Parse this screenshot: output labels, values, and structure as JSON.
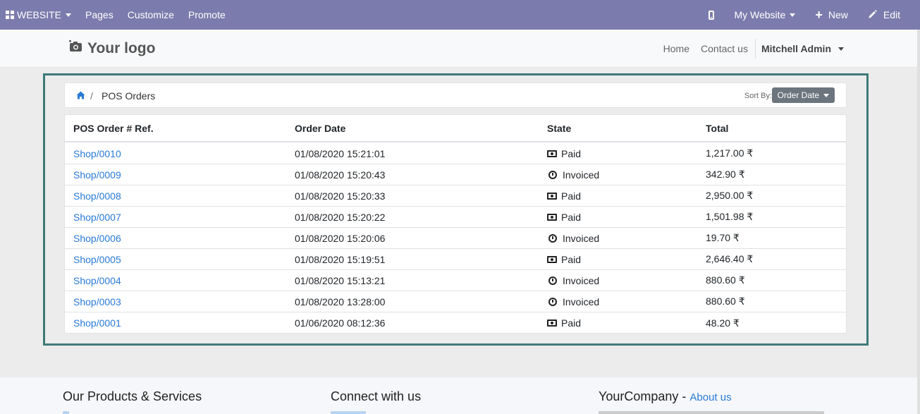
{
  "topbar": {
    "website_label": "WEBSITE",
    "pages_label": "Pages",
    "customize_label": "Customize",
    "promote_label": "Promote",
    "my_website_label": "My Website",
    "new_label": "New",
    "edit_label": "Edit"
  },
  "header": {
    "logo_text": "Your logo",
    "nav": [
      "Home",
      "Contact us"
    ],
    "user_name": "Mitchell Admin"
  },
  "breadcrumb": {
    "current": "POS Orders",
    "sort_label": "Sort By:",
    "sort_value": "Order Date"
  },
  "table": {
    "columns": [
      "POS Order # Ref.",
      "Order Date",
      "State",
      "Total"
    ],
    "rows": [
      {
        "ref": "Shop/0010",
        "date": "01/08/2020  15:21:01",
        "state": "Paid",
        "state_icon": "money-icon",
        "total": "1,217.00 ₹"
      },
      {
        "ref": "Shop/0009",
        "date": "01/08/2020  15:20:43",
        "state": "Invoiced",
        "state_icon": "clock-icon",
        "total": "342.90 ₹"
      },
      {
        "ref": "Shop/0008",
        "date": "01/08/2020  15:20:33",
        "state": "Paid",
        "state_icon": "money-icon",
        "total": "2,950.00 ₹"
      },
      {
        "ref": "Shop/0007",
        "date": "01/08/2020  15:20:22",
        "state": "Paid",
        "state_icon": "money-icon",
        "total": "1,501.98 ₹"
      },
      {
        "ref": "Shop/0006",
        "date": "01/08/2020  15:20:06",
        "state": "Invoiced",
        "state_icon": "clock-icon",
        "total": "19.70 ₹"
      },
      {
        "ref": "Shop/0005",
        "date": "01/08/2020  15:19:51",
        "state": "Paid",
        "state_icon": "money-icon",
        "total": "2,646.40 ₹"
      },
      {
        "ref": "Shop/0004",
        "date": "01/08/2020  15:13:21",
        "state": "Invoiced",
        "state_icon": "clock-icon",
        "total": "880.60 ₹"
      },
      {
        "ref": "Shop/0003",
        "date": "01/08/2020  13:28:00",
        "state": "Invoiced",
        "state_icon": "clock-icon",
        "total": "880.60 ₹"
      },
      {
        "ref": "Shop/0001",
        "date": "01/06/2020  08:12:36",
        "state": "Paid",
        "state_icon": "money-icon",
        "total": "48.20 ₹"
      }
    ]
  },
  "footer": {
    "col1_title": "Our Products & Services",
    "col2_title": "Connect with us",
    "col3_title": "YourCompany",
    "col3_sep": " - ",
    "col3_link": "About us"
  },
  "colors": {
    "topbar_bg": "#7c7bad",
    "frame_border": "#3e7a78",
    "link": "#2a7ad6",
    "sort_button": "#6c757d"
  }
}
